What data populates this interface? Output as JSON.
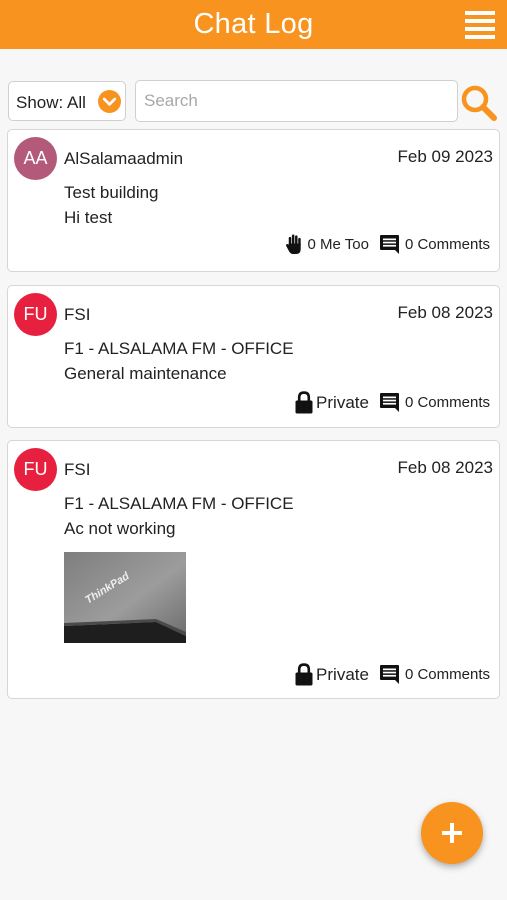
{
  "header": {
    "title": "Chat Log",
    "menu_icon": "hamburger-menu-icon"
  },
  "filter": {
    "show_label": "Show: All",
    "dropdown_icon": "chevron-down-circle-icon",
    "search_placeholder": "Search",
    "search_value": "",
    "search_icon": "magnifier-icon"
  },
  "posts": [
    {
      "avatar_initials": "AA",
      "avatar_color": "#b35a7a",
      "author": "AlSalamaadmin",
      "date": "Feb 09 2023",
      "line1": "Test building",
      "line2": "Hi test",
      "action1_icon": "raised-hand-icon",
      "action1_text": "0 Me Too",
      "comments_icon": "comment-icon",
      "comments_text": "0 Comments"
    },
    {
      "avatar_initials": "FU",
      "avatar_color": "#e8203f",
      "author": "FSI",
      "date": "Feb 08 2023",
      "line1": "F1 - ALSALAMA FM - OFFICE",
      "line2": "General maintenance",
      "action1_icon": "lock-icon",
      "action1_text": "Private",
      "comments_icon": "comment-icon",
      "comments_text": "0 Comments"
    },
    {
      "avatar_initials": "FU",
      "avatar_color": "#e8203f",
      "author": "FSI",
      "date": "Feb 08 2023",
      "line1": "F1 - ALSALAMA FM - OFFICE",
      "line2": "Ac not working",
      "attachment_brand": "ThinkPad",
      "action1_icon": "lock-icon",
      "action1_text": "Private",
      "comments_icon": "comment-icon",
      "comments_text": "0 Comments"
    }
  ],
  "fab": {
    "icon": "plus-icon"
  },
  "colors": {
    "accent": "#f7931e",
    "background": "#f7f7f7",
    "card_border": "#d6d6d6"
  }
}
